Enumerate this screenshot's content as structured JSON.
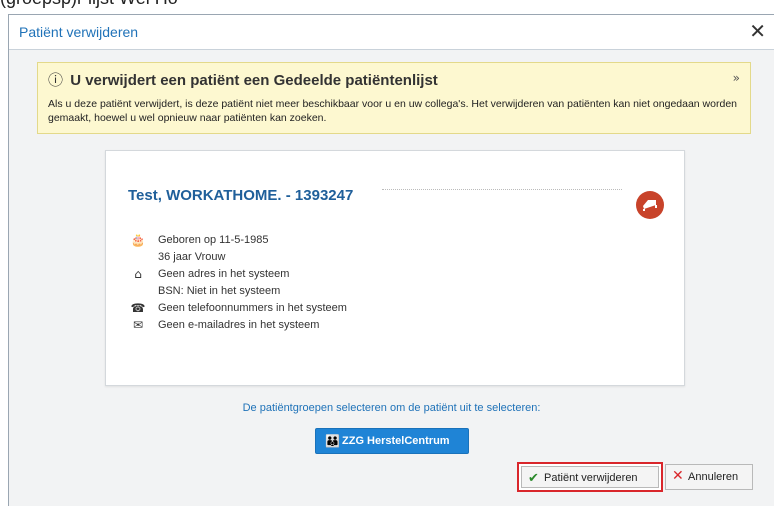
{
  "background": {
    "fragment_text": "(groepsp)r lijst Wel Ho"
  },
  "dialog": {
    "title": "Patiënt verwijderen",
    "close_symbol": "✕"
  },
  "warning": {
    "icon": "info-icon",
    "title": "U verwijdert een patiënt een Gedeelde patiëntenlijst",
    "collapse_symbol": "»",
    "body": "Als u deze patiënt verwijdert, is deze patiënt niet meer beschikbaar voor u en uw collega's. Het verwijderen van patiënten kan niet ongedaan worden gemaakt, hoewel u wel opnieuw naar patiënten kan zoeken."
  },
  "patient": {
    "name": "Test, WORKATHOME. - 1393247",
    "type_icon": "bed-icon",
    "type_icon_color": "#c8432a",
    "birth": "Geboren op 11-5-1985",
    "age_gender": "36 jaar Vrouw",
    "address": "Geen adres in het systeem",
    "bsn": "BSN: Niet in het systeem",
    "phone": "Geen telefoonnummers in het systeem",
    "email": "Geen e-mailadres in het systeem"
  },
  "groups": {
    "label": "De patiëntgroepen selecteren om de patiënt uit te selecteren:",
    "button_label": "ZZG HerstelCentrum",
    "button_color": "#1f84d6"
  },
  "actions": {
    "delete_label": "Patiënt verwijderen",
    "cancel_label": "Annuleren",
    "highlight_color": "#d9262b"
  }
}
